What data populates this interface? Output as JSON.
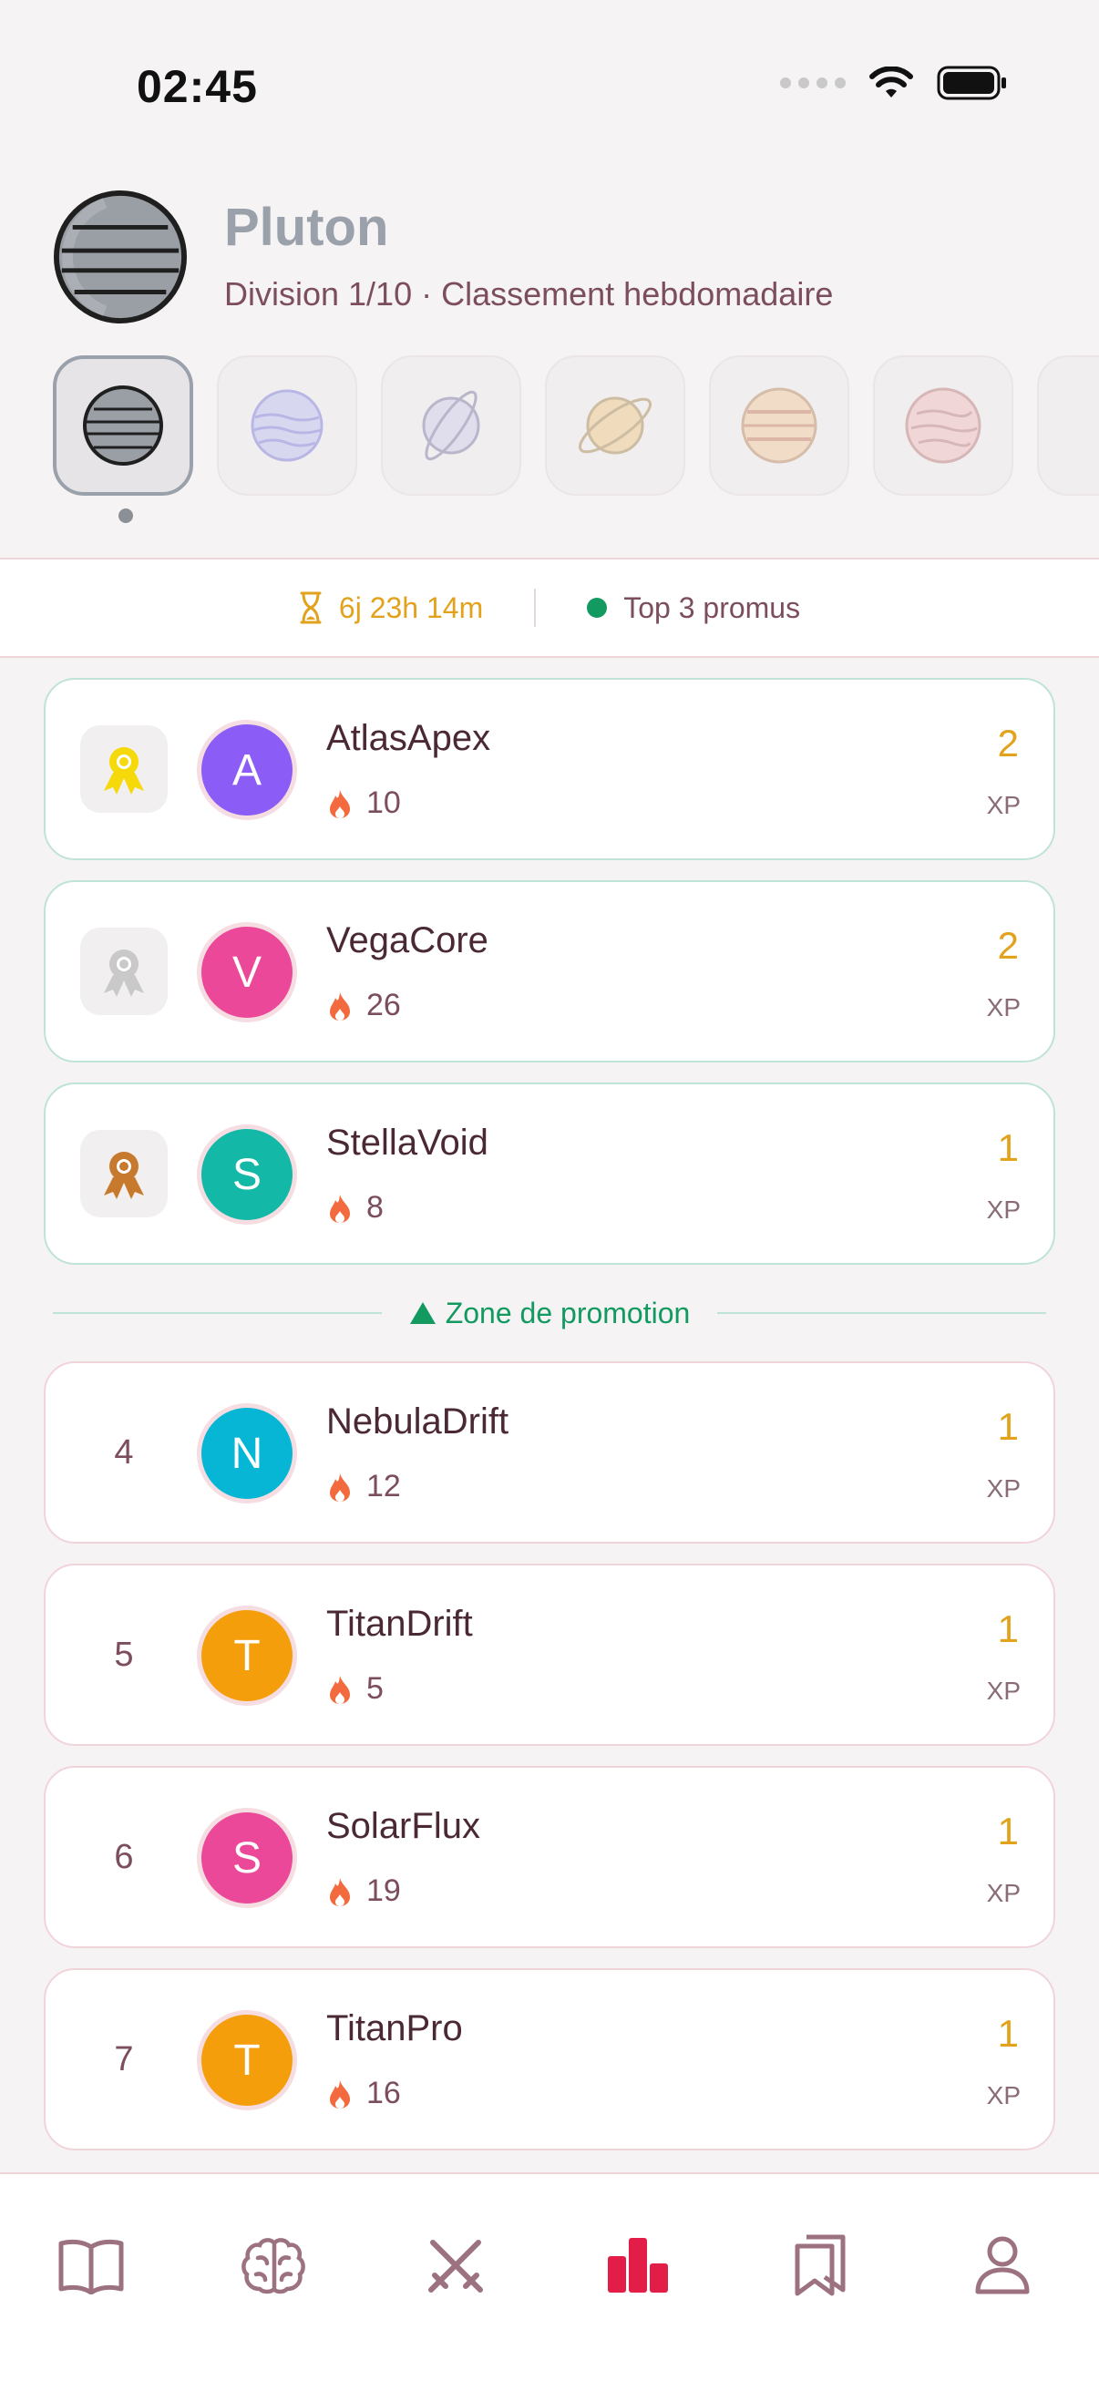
{
  "status_bar": {
    "time": "02:45"
  },
  "league": {
    "name": "Pluton",
    "subtitle": "Division 1/10 · Classement hebdomadaire",
    "planets": [
      "pluto-icon",
      "neptune-icon",
      "uranus-icon",
      "saturn-icon",
      "jupiter-icon",
      "mars-icon"
    ]
  },
  "info": {
    "timer": "6j 23h 14m",
    "promo": "Top 3 promus"
  },
  "zone": {
    "label": "Zone de promotion"
  },
  "xp_label": "XP",
  "colors": {
    "accent": "#e11d48",
    "gold": "#e2a21c",
    "green": "#129a60"
  },
  "leaderboard": [
    {
      "rank": "1",
      "name": "AtlasApex",
      "initial": "A",
      "streak": "10",
      "xp": "2",
      "avatar_color": "#8b5cf6",
      "medal": "gold"
    },
    {
      "rank": "2",
      "name": "VegaCore",
      "initial": "V",
      "streak": "26",
      "xp": "2",
      "avatar_color": "#ec4899",
      "medal": "silver"
    },
    {
      "rank": "3",
      "name": "StellaVoid",
      "initial": "S",
      "streak": "8",
      "xp": "1",
      "avatar_color": "#14b8a6",
      "medal": "bronze"
    },
    {
      "rank": "4",
      "name": "NebulaDrift",
      "initial": "N",
      "streak": "12",
      "xp": "1",
      "avatar_color": "#06b6d4"
    },
    {
      "rank": "5",
      "name": "TitanDrift",
      "initial": "T",
      "streak": "5",
      "xp": "1",
      "avatar_color": "#f59e0b"
    },
    {
      "rank": "6",
      "name": "SolarFlux",
      "initial": "S",
      "streak": "19",
      "xp": "1",
      "avatar_color": "#ec4899"
    },
    {
      "rank": "7",
      "name": "TitanPro",
      "initial": "T",
      "streak": "16",
      "xp": "1",
      "avatar_color": "#f59e0b"
    }
  ],
  "nav": {
    "items": [
      "book-icon",
      "brain-icon",
      "swords-icon",
      "leaderboard-icon",
      "bookmarks-icon",
      "profile-icon"
    ],
    "active": "leaderboard-icon"
  }
}
